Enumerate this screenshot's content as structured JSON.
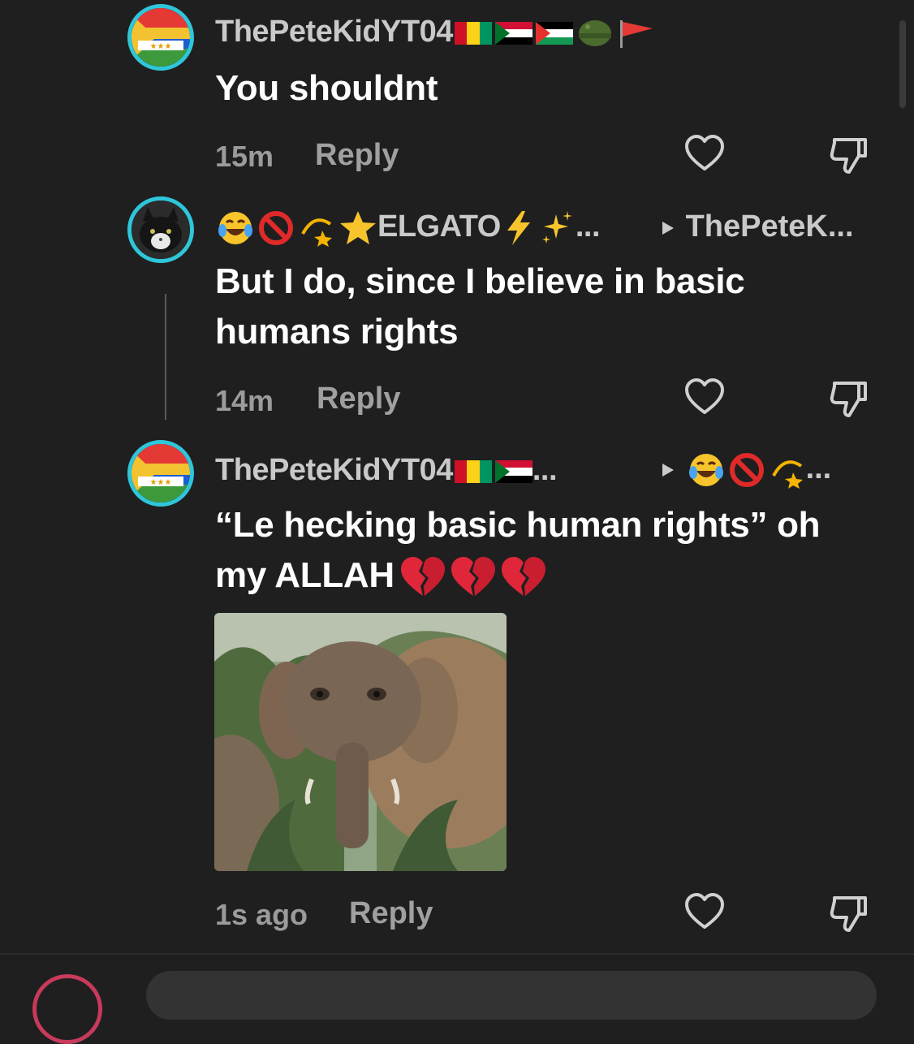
{
  "comments": [
    {
      "username": "ThePeteKidYT04",
      "text": "You shouldnt",
      "time": "15m",
      "reply_label": "Reply"
    },
    {
      "username": "ELGATO",
      "username_suffix": "...",
      "reply_to": "ThePeteK...",
      "text_line1": "But I do, since I believe in basic",
      "text_line2": "humans rights",
      "time": "14m",
      "reply_label": "Reply"
    },
    {
      "username": "ThePeteKidYT04",
      "username_suffix": "...",
      "reply_to_suffix": "...",
      "text_line1": "“Le hecking basic human rights” oh",
      "text_line2": "my ALLAH",
      "time": "1s ago",
      "reply_label": "Reply"
    }
  ],
  "icons": {
    "like": "heart-outline-icon",
    "dislike": "thumbs-down-icon",
    "arrow": "play-triangle-icon"
  },
  "colors": {
    "background": "#1f1f20",
    "avatar_ring": "#2fc6d9",
    "username": "#c9c9c9",
    "meta": "#9b9b9b"
  }
}
